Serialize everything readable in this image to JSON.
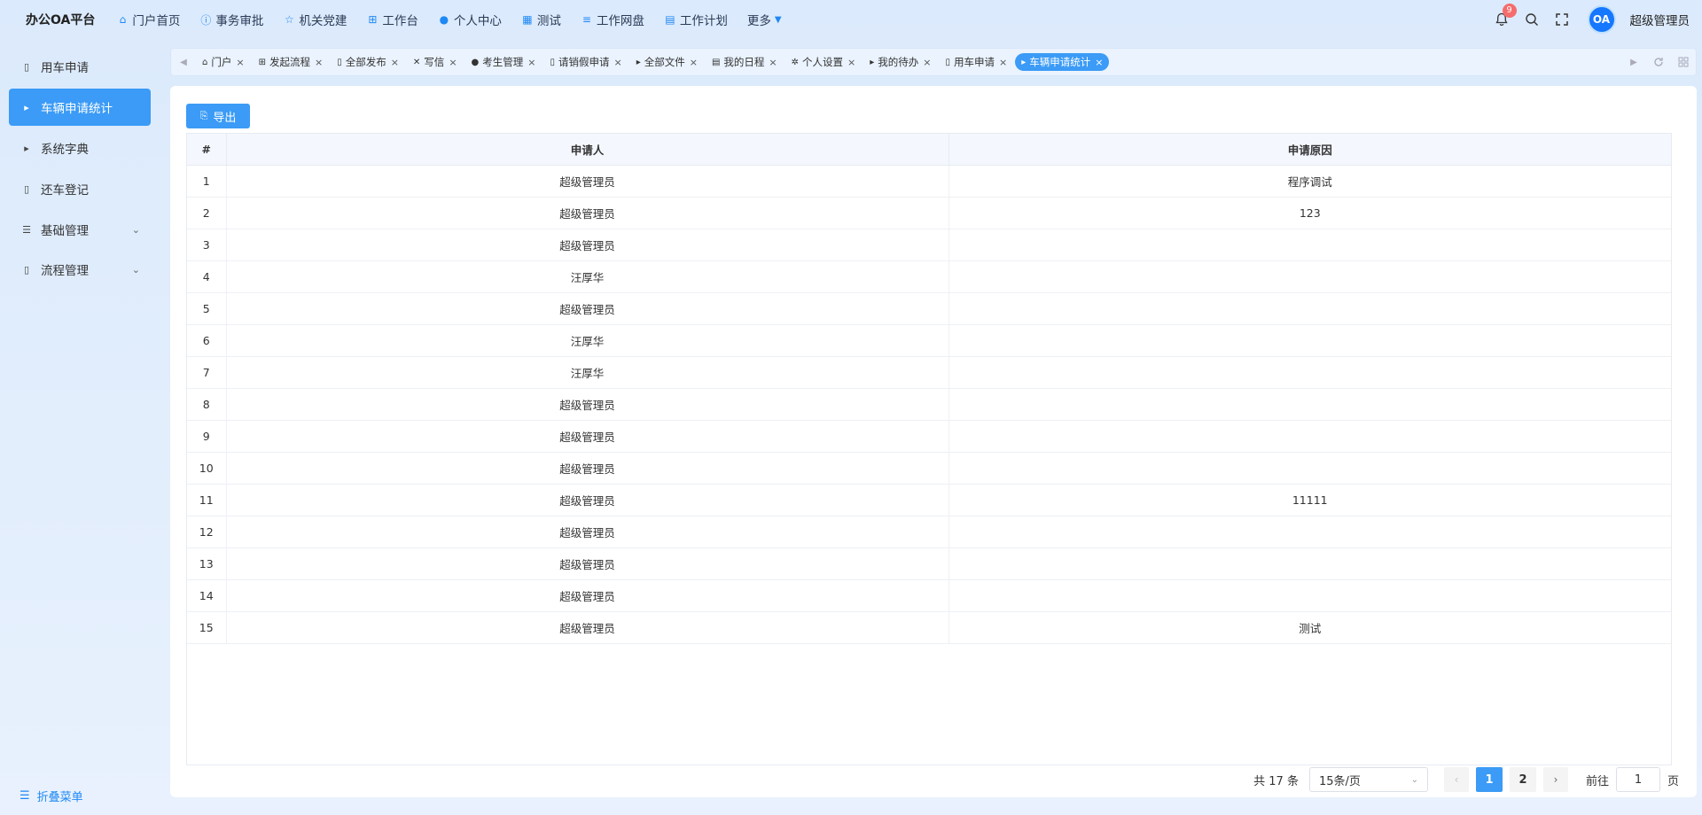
{
  "brand": "办公OA平台",
  "topnav": [
    {
      "label": "门户首页",
      "icon": "home-icon"
    },
    {
      "label": "事务审批",
      "icon": "info-icon"
    },
    {
      "label": "机关党建",
      "icon": "star-icon"
    },
    {
      "label": "工作台",
      "icon": "sitemap-icon"
    },
    {
      "label": "个人中心",
      "icon": "user-icon"
    },
    {
      "label": "测试",
      "icon": "grid-icon"
    },
    {
      "label": "工作网盘",
      "icon": "database-icon"
    },
    {
      "label": "工作计划",
      "icon": "calendar-icon"
    },
    {
      "label": "更多",
      "icon": "chevron-down-icon"
    }
  ],
  "top_right": {
    "notification_count": "9",
    "avatar_text": "OA",
    "username": "超级管理员"
  },
  "sidebar": {
    "items": [
      {
        "label": "用车申请",
        "icon": "document-icon",
        "active": false
      },
      {
        "label": "车辆申请统计",
        "icon": "caret-right-icon",
        "active": true
      },
      {
        "label": "系统字典",
        "icon": "caret-right-icon",
        "active": false
      },
      {
        "label": "还车登记",
        "icon": "document-icon",
        "active": false
      },
      {
        "label": "基础管理",
        "icon": "list-icon",
        "active": false,
        "expandable": true
      },
      {
        "label": "流程管理",
        "icon": "book-icon",
        "active": false,
        "expandable": true
      }
    ],
    "collapse_label": "折叠菜单"
  },
  "tabs": [
    {
      "label": "门户",
      "icon": "home-icon",
      "active": false
    },
    {
      "label": "发起流程",
      "icon": "sitemap-icon",
      "active": false
    },
    {
      "label": "全部发布",
      "icon": "document-icon",
      "active": false
    },
    {
      "label": "写信",
      "icon": "tools-icon",
      "active": false
    },
    {
      "label": "考生管理",
      "icon": "user-icon",
      "active": false
    },
    {
      "label": "请销假申请",
      "icon": "document-icon",
      "active": false
    },
    {
      "label": "全部文件",
      "icon": "caret-right-icon",
      "active": false
    },
    {
      "label": "我的日程",
      "icon": "calendar-icon",
      "active": false
    },
    {
      "label": "个人设置",
      "icon": "gear-icon",
      "active": false
    },
    {
      "label": "我的待办",
      "icon": "caret-right-icon",
      "active": false
    },
    {
      "label": "用车申请",
      "icon": "document-icon",
      "active": false
    },
    {
      "label": "车辆申请统计",
      "icon": "caret-right-icon",
      "active": true
    }
  ],
  "toolbar": {
    "export_label": "导出"
  },
  "table": {
    "headers": [
      "#",
      "申请人",
      "申请原因"
    ],
    "rows": [
      [
        "1",
        "超级管理员",
        "程序调试"
      ],
      [
        "2",
        "超级管理员",
        "123"
      ],
      [
        "3",
        "超级管理员",
        ""
      ],
      [
        "4",
        "汪厚华",
        ""
      ],
      [
        "5",
        "超级管理员",
        ""
      ],
      [
        "6",
        "汪厚华",
        ""
      ],
      [
        "7",
        "汪厚华",
        ""
      ],
      [
        "8",
        "超级管理员",
        ""
      ],
      [
        "9",
        "超级管理员",
        ""
      ],
      [
        "10",
        "超级管理员",
        ""
      ],
      [
        "11",
        "超级管理员",
        "11111"
      ],
      [
        "12",
        "超级管理员",
        ""
      ],
      [
        "13",
        "超级管理员",
        ""
      ],
      [
        "14",
        "超级管理员",
        ""
      ],
      [
        "15",
        "超级管理员",
        "测试"
      ]
    ]
  },
  "pagination": {
    "total_text": "共 17 条",
    "page_size": "15条/页",
    "pages": [
      "1",
      "2"
    ],
    "current_page": "1",
    "goto_label": "前往",
    "goto_value": "1",
    "page_suffix": "页"
  }
}
